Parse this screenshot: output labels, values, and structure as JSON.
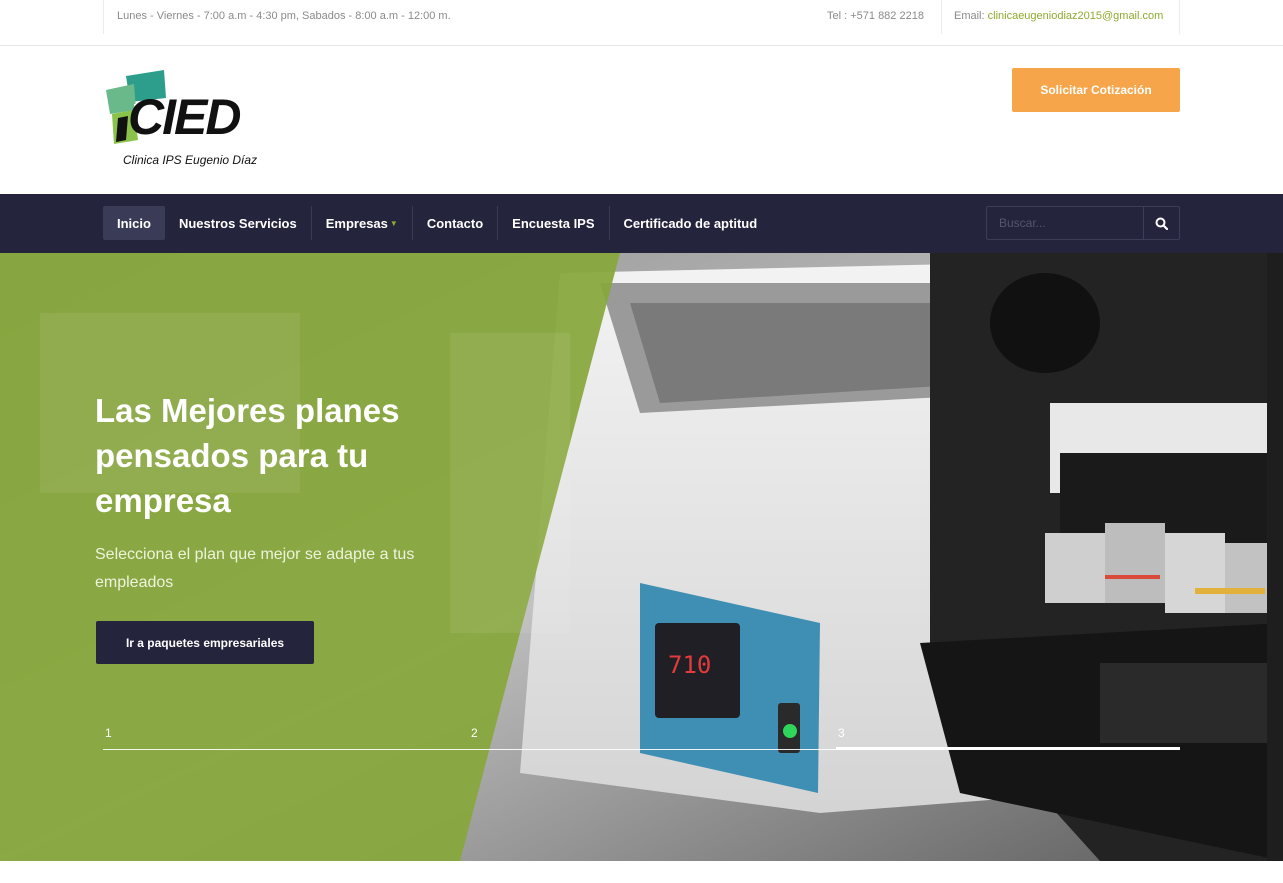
{
  "topbar": {
    "hours": "Lunes - Viernes - 7:00 a.m - 4:30 pm, Sabados - 8:00 a.m - 12:00 m.",
    "tel": "Tel : +571 882 2218",
    "email_label": "Email:",
    "email": "clinicaeugeniodiaz2015@gmail.com"
  },
  "header": {
    "logo_text": "CIED",
    "logo_tagline": "Clinica IPS Eugenio Díaz",
    "quote_button": "Solicitar Cotización"
  },
  "nav": {
    "items": [
      {
        "label": "Inicio",
        "active": true
      },
      {
        "label": "Nuestros Servicios"
      },
      {
        "label": "Empresas"
      },
      {
        "label": "Contacto"
      },
      {
        "label": "Encuesta IPS"
      },
      {
        "label": "Certificado de aptitud"
      }
    ],
    "search_placeholder": "Buscar..."
  },
  "hero": {
    "title": "Las Mejores planes pensados para tu empresa",
    "subtitle": "Selecciona el plan que mejor se adapte a tus empleados",
    "cta": "Ir a paquetes empresariales",
    "slides": [
      "1",
      "2",
      "3"
    ],
    "active_slide": 3
  },
  "colors": {
    "nav_bg": "#24243c",
    "accent_green": "#8aab2f",
    "accent_orange": "#f6a54a",
    "hero_overlay": "#86a73a"
  }
}
